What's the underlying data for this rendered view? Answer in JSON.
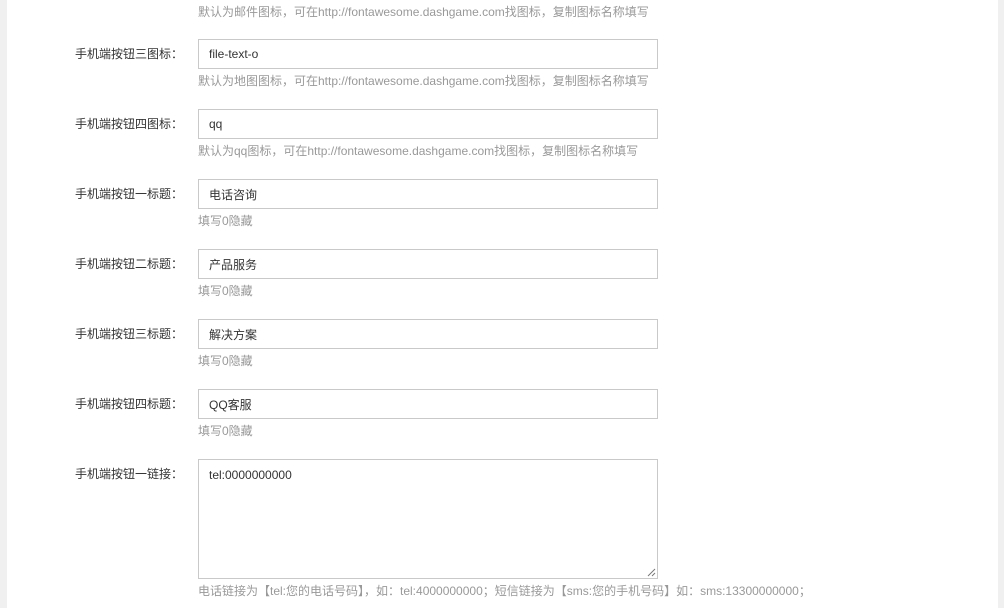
{
  "form": {
    "top_hint": "默认为邮件图标，可在http://fontawesome.dashgame.com找图标，复制图标名称填写",
    "rows": [
      {
        "label": "手机端按钮三图标：",
        "value": "file-text-o",
        "hint": "默认为地图图标，可在http://fontawesome.dashgame.com找图标，复制图标名称填写"
      },
      {
        "label": "手机端按钮四图标：",
        "value": "qq",
        "hint": "默认为qq图标，可在http://fontawesome.dashgame.com找图标，复制图标名称填写"
      },
      {
        "label": "手机端按钮一标题：",
        "value": "电话咨询",
        "hint": "填写0隐藏"
      },
      {
        "label": "手机端按钮二标题：",
        "value": "产品服务",
        "hint": "填写0隐藏"
      },
      {
        "label": "手机端按钮三标题：",
        "value": "解决方案",
        "hint": "填写0隐藏"
      },
      {
        "label": "手机端按钮四标题：",
        "value": "QQ客服",
        "hint": "填写0隐藏"
      }
    ],
    "link_row": {
      "label": "手机端按钮一链接：",
      "value": "tel:0000000000",
      "hint": "电话链接为【tel:您的电话号码】，如：tel:4000000000；短信链接为【sms:您的手机号码】如：sms:13300000000；"
    }
  }
}
